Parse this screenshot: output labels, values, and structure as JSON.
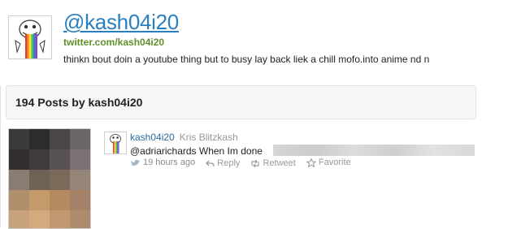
{
  "profile": {
    "handle": "@kash04i20",
    "url": "twitter.com/kash04i20",
    "bio": "thinkn bout doin a youtube thing but to busy lay back liek a chill mofo.into anime nd n"
  },
  "posts_header": {
    "title": "194 Posts by kash04i20"
  },
  "tweet": {
    "handle": "kash04i20",
    "name": "Kris Blitzkash",
    "text": "@adriarichards When Im done",
    "time": "19 hours ago",
    "reply_label": "Reply",
    "retweet_label": "Retweet",
    "favorite_label": "Favorite"
  },
  "colors": {
    "link": "#2a7fbf",
    "url_green": "#5e8f2a",
    "meta_gray": "#999999"
  }
}
